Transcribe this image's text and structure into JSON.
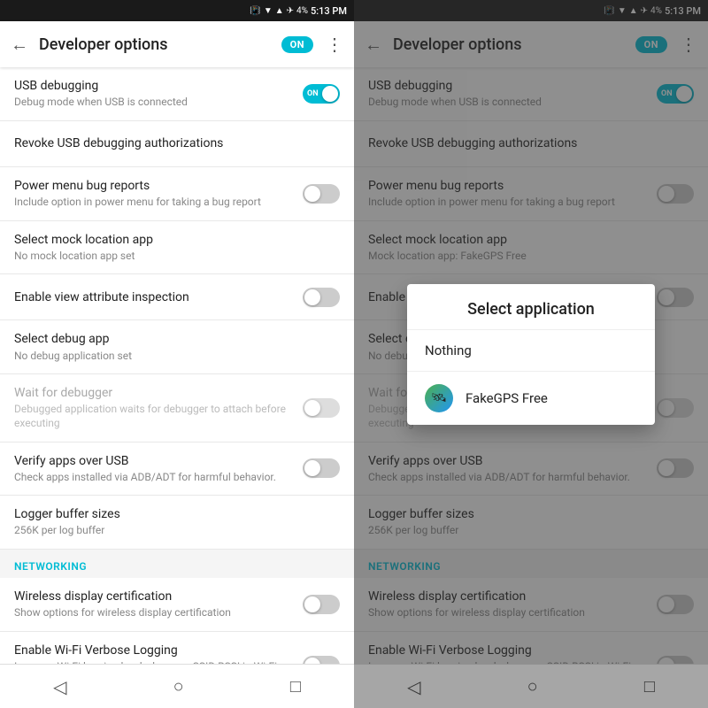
{
  "status": {
    "icons": "📳 ▼ ✈",
    "battery": "4%",
    "time": "5:13 PM"
  },
  "header": {
    "back_label": "←",
    "title": "Developer options",
    "toggle_label": "ON",
    "more_label": "⋮"
  },
  "settings": [
    {
      "id": "usb-debugging",
      "title": "USB debugging",
      "subtitle": "Debug mode when USB is connected",
      "has_toggle": true,
      "toggle_state": "on",
      "disabled": false
    },
    {
      "id": "revoke-usb",
      "title": "Revoke USB debugging authorizations",
      "subtitle": "",
      "has_toggle": false,
      "disabled": false
    },
    {
      "id": "power-menu-bug",
      "title": "Power menu bug reports",
      "subtitle": "Include option in power menu for taking a bug report",
      "has_toggle": true,
      "toggle_state": "off",
      "disabled": false
    },
    {
      "id": "mock-location",
      "title": "Select mock location app",
      "subtitle_left": "No mock location app set",
      "subtitle_right": "Mock location app: FakeGPS Free",
      "has_toggle": false,
      "disabled": false
    },
    {
      "id": "view-attribute",
      "title": "Enable view attribute inspection",
      "subtitle": "",
      "has_toggle": true,
      "toggle_state": "off",
      "disabled": false
    },
    {
      "id": "debug-app",
      "title": "Select debug app",
      "subtitle_left": "No debug application set",
      "subtitle_right": "No debug application set",
      "has_toggle": false,
      "disabled": false
    },
    {
      "id": "wait-debugger",
      "title": "Wait for debugger",
      "subtitle": "Debugged application waits for debugger to attach before executing",
      "has_toggle": true,
      "toggle_state": "off",
      "disabled": true
    },
    {
      "id": "verify-apps",
      "title": "Verify apps over USB",
      "subtitle": "Check apps installed via ADB/ADT for harmful behavior.",
      "has_toggle": true,
      "toggle_state": "off",
      "disabled": false
    },
    {
      "id": "logger-buffer",
      "title": "Logger buffer sizes",
      "subtitle": "256K per log buffer",
      "has_toggle": false,
      "disabled": false
    }
  ],
  "networking_section": "NETWORKING",
  "networking_settings": [
    {
      "id": "wireless-display",
      "title": "Wireless display certification",
      "subtitle": "Show options for wireless display certification",
      "has_toggle": true,
      "toggle_state": "off",
      "disabled": false
    },
    {
      "id": "wifi-verbose",
      "title": "Enable Wi-Fi Verbose Logging",
      "subtitle": "Increase Wi-Fi logging level, show per SSID RSSI in Wi-Fi Picker",
      "has_toggle": true,
      "toggle_state": "off",
      "disabled": false
    }
  ],
  "nav": {
    "back": "◁",
    "home": "○",
    "recents": "□"
  },
  "dialog": {
    "title": "Select application",
    "items": [
      {
        "label": "Nothing",
        "has_icon": false
      },
      {
        "label": "FakeGPS Free",
        "has_icon": true,
        "icon": "🛰"
      }
    ]
  },
  "left_panel": {
    "mock_subtitle": "No mock location app set"
  },
  "right_panel": {
    "mock_subtitle": "Mock location app: FakeGPS Free"
  }
}
